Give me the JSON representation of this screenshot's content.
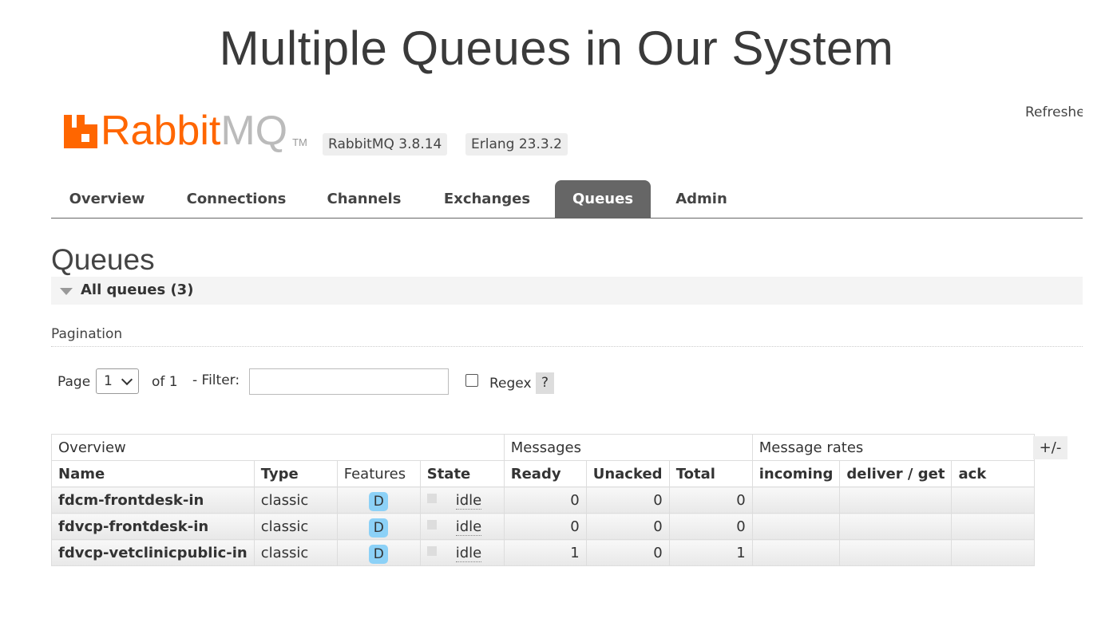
{
  "slide": {
    "title": "Multiple Queues in Our System"
  },
  "header": {
    "logo_rabbit": "Rabbit",
    "logo_mq": "MQ",
    "logo_tm": "TM",
    "rabbitmq_version": "RabbitMQ 3.8.14",
    "erlang_version": "Erlang 23.3.2",
    "refreshed": "Refreshed"
  },
  "nav": {
    "tabs": [
      {
        "label": "Overview"
      },
      {
        "label": "Connections"
      },
      {
        "label": "Channels"
      },
      {
        "label": "Exchanges"
      },
      {
        "label": "Queues",
        "active": true
      },
      {
        "label": "Admin"
      }
    ]
  },
  "page": {
    "heading": "Queues",
    "section_label": "All queues (3)",
    "pagination_title": "Pagination",
    "page_label": "Page",
    "page_value": "1",
    "of_label": "of 1",
    "filter_label": "- Filter:",
    "filter_value": "",
    "regex_label": "Regex",
    "help": "?"
  },
  "table": {
    "groups": [
      "Overview",
      "Messages",
      "Message rates"
    ],
    "columns": [
      "Name",
      "Type",
      "Features",
      "State",
      "Ready",
      "Unacked",
      "Total",
      "incoming",
      "deliver / get",
      "ack"
    ],
    "toggle": "+/-",
    "rows": [
      {
        "name": "fdcm-frontdesk-in",
        "type": "classic",
        "feature": "D",
        "state": "idle",
        "ready": "0",
        "unacked": "0",
        "total": "0"
      },
      {
        "name": "fdvcp-frontdesk-in",
        "type": "classic",
        "feature": "D",
        "state": "idle",
        "ready": "0",
        "unacked": "0",
        "total": "0"
      },
      {
        "name": "fdvcp-vetclinicpublic-in",
        "type": "classic",
        "feature": "D",
        "state": "idle",
        "ready": "1",
        "unacked": "0",
        "total": "1"
      }
    ]
  },
  "colors": {
    "brand": "#ff6600",
    "active_tab": "#666666",
    "feature_badge": "#8cd1f7"
  }
}
